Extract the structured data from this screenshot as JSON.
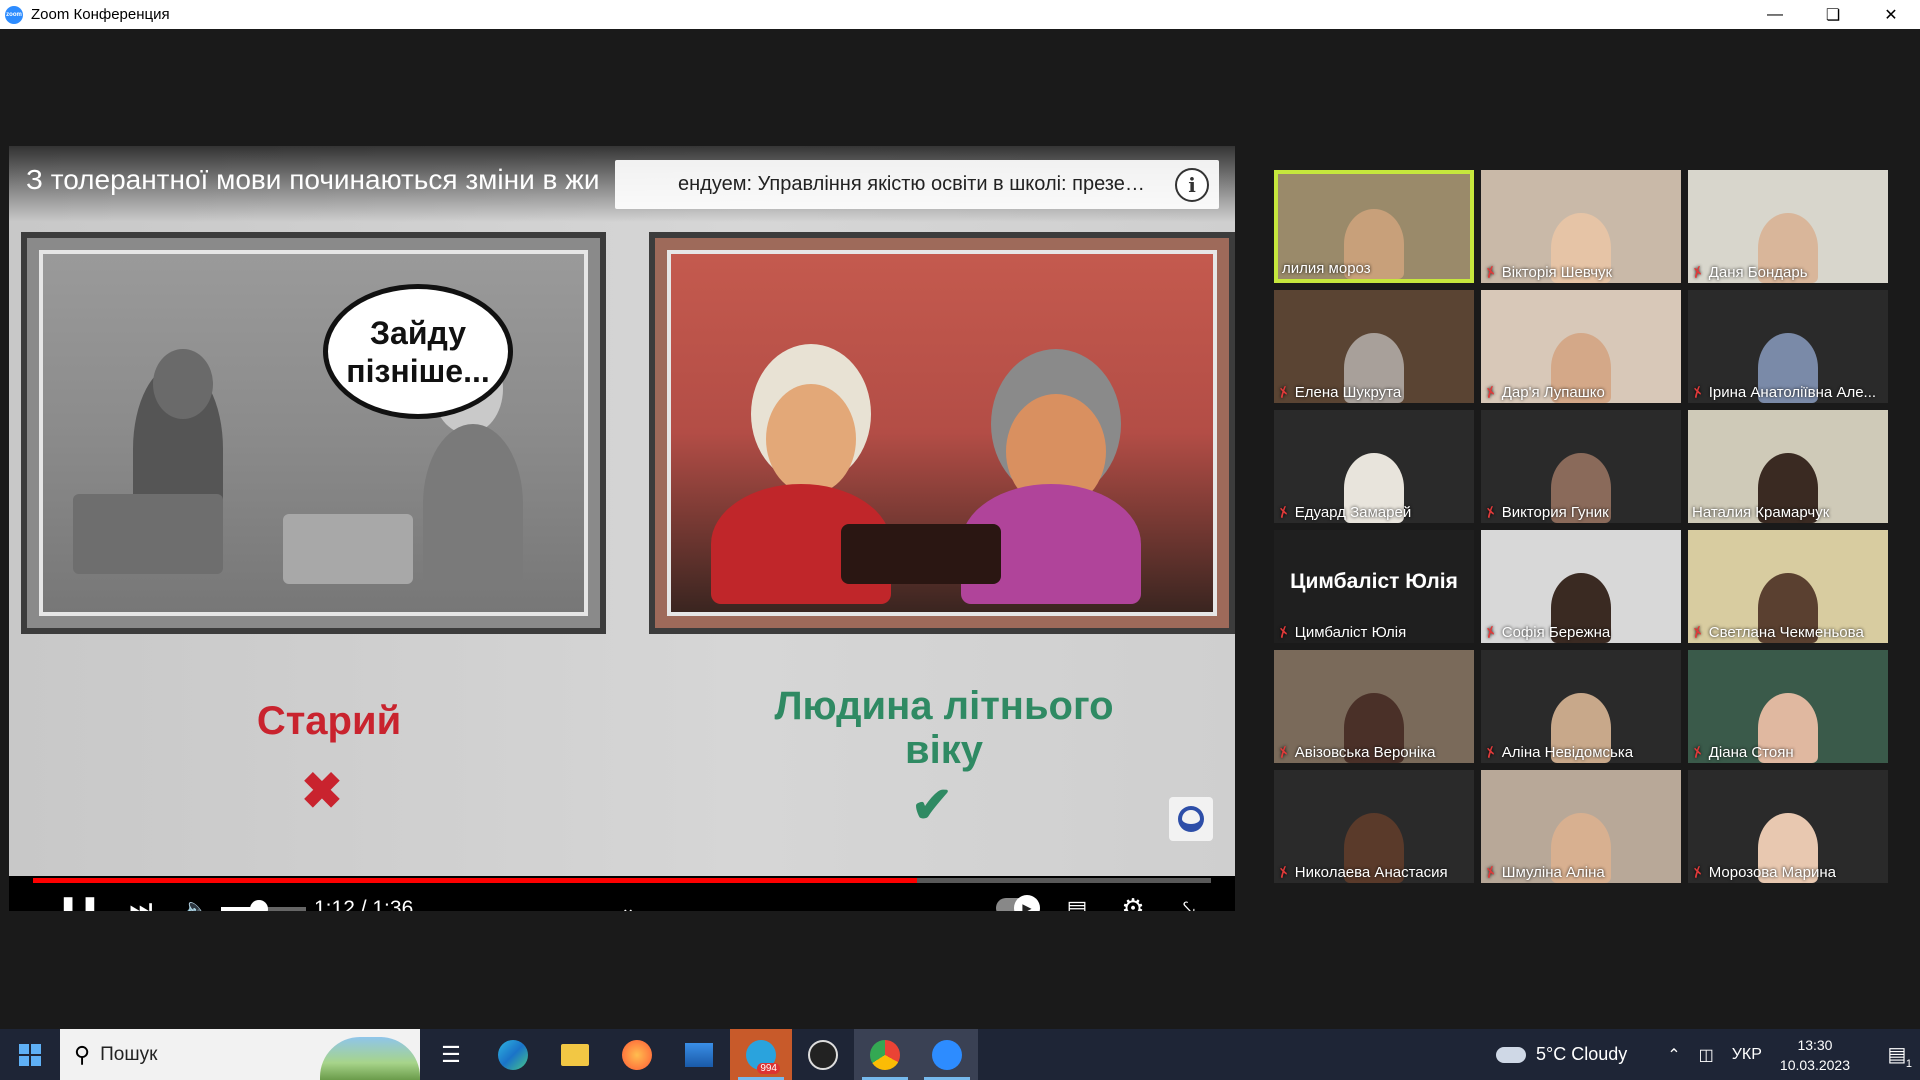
{
  "window": {
    "title": "Zoom Конференция",
    "logo_text": "zoom"
  },
  "video": {
    "title": "З толерантної мови починаються зміни в жи",
    "popup_title": "ендуем: Управління якістю освіти в школі: презентація...",
    "time_current": "1:12",
    "time_total": "1:36",
    "time_display": "1:12 / 1:36",
    "progress": 0.75,
    "volume": 0.45
  },
  "slide": {
    "bubble_line1": "Зайду",
    "bubble_line2": "пізніше...",
    "bad_label": "Старий",
    "good_label_line1": "Людина літнього",
    "good_label_line2": "віку",
    "bad_color": "#c9232e",
    "good_color": "#2f8a63"
  },
  "participants": [
    {
      "name": "лилия мороз",
      "muted": false,
      "active": true,
      "bg": "#9a8a6a",
      "face": "#c8a07a"
    },
    {
      "name": "Вікторія Шевчук",
      "muted": true,
      "active": false,
      "bg": "#c9b9a8",
      "face": "#e6c4a6"
    },
    {
      "name": "Даня Бондарь",
      "muted": true,
      "active": false,
      "bg": "#d8d6cc",
      "face": "#d9b69a"
    },
    {
      "name": "Елена Шукрута",
      "muted": true,
      "active": false,
      "bg": "#5a4433",
      "face": "#a8a09a"
    },
    {
      "name": "Дар'я Лупашко",
      "muted": true,
      "active": false,
      "bg": "#d8c8b8",
      "face": "#d4a888"
    },
    {
      "name": "Ірина Анатоліївна Але...",
      "muted": true,
      "active": false,
      "bg": "#2a2a2a",
      "face": "#7a8aa8"
    },
    {
      "name": "Едуард Замарей",
      "muted": true,
      "active": false,
      "bg": "#2a2a2a",
      "face": "#e8e4dc"
    },
    {
      "name": "Виктория Гуник",
      "muted": true,
      "active": false,
      "bg": "#2a2a2a",
      "face": "#8a6a5a"
    },
    {
      "name": "Наталия Крамарчук",
      "muted": false,
      "active": false,
      "bg": "#cfcab8",
      "face": "#3a2a22"
    },
    {
      "name": "Цимбаліст Юлія",
      "muted": true,
      "active": false,
      "bg": "#1f1f1f",
      "face": "",
      "big": "Цимбаліст Юлія"
    },
    {
      "name": "Софія Бережна",
      "muted": true,
      "active": false,
      "bg": "#d8d8d8",
      "face": "#3a2a22"
    },
    {
      "name": "Светлана Чекменьова",
      "muted": true,
      "active": false,
      "bg": "#d8cca0",
      "face": "#5a4030"
    },
    {
      "name": "Авізовська Вероніка",
      "muted": true,
      "active": false,
      "bg": "#7a6a5a",
      "face": "#4a3028"
    },
    {
      "name": "Аліна Невідомська",
      "muted": true,
      "active": false,
      "bg": "#2a2a2a",
      "face": "#c8a88a"
    },
    {
      "name": "Діана Стоян",
      "muted": true,
      "active": false,
      "bg": "#3a5a4a",
      "face": "#e0b8a0"
    },
    {
      "name": "Николаева Анастасия",
      "muted": true,
      "active": false,
      "bg": "#2a2a2a",
      "face": "#5a3a2a"
    },
    {
      "name": "Шмуліна Аліна",
      "muted": true,
      "active": false,
      "bg": "#b8a898",
      "face": "#d8b090"
    },
    {
      "name": "Морозова Марина",
      "muted": true,
      "active": false,
      "bg": "#2a2a2a",
      "face": "#e8c8b0"
    }
  ],
  "taskbar": {
    "search_placeholder": "Пошук",
    "telegram_badge": "994",
    "weather": "5°C  Cloudy",
    "language": "УКР",
    "time": "13:30",
    "date": "10.03.2023",
    "notification_count": "1"
  },
  "icons": {
    "minimize": "minimize-icon",
    "restore": "restore-icon",
    "close": "close-icon"
  }
}
